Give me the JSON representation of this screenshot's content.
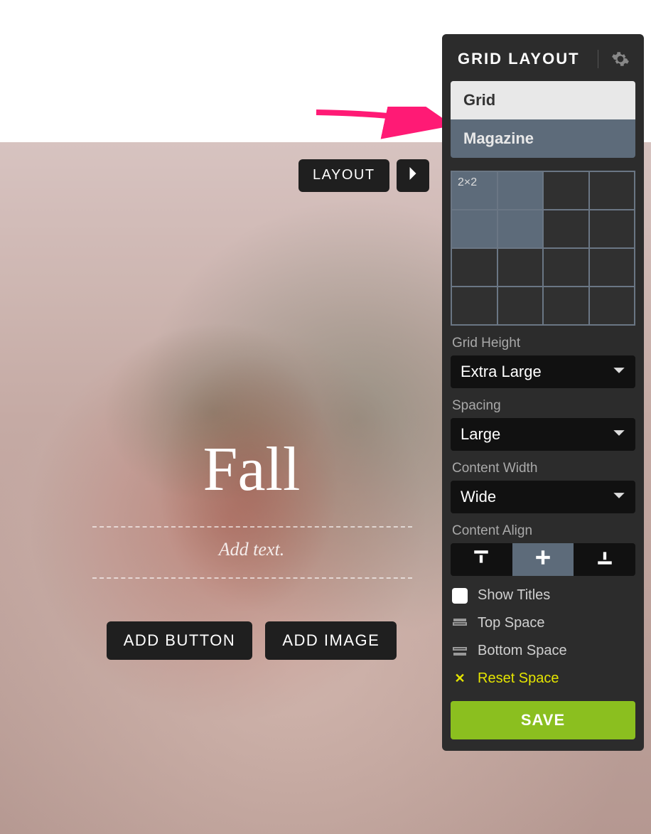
{
  "canvas": {
    "layout_button": "LAYOUT",
    "title": "Fall",
    "add_text_placeholder": "Add text.",
    "add_button_label": "ADD BUTTON",
    "add_image_label": "ADD IMAGE"
  },
  "panel": {
    "title": "GRID LAYOUT",
    "tabs": {
      "grid": "Grid",
      "magazine": "Magazine",
      "selected": "grid"
    },
    "grid_size_label": "2×2",
    "grid_height": {
      "label": "Grid Height",
      "value": "Extra Large"
    },
    "spacing": {
      "label": "Spacing",
      "value": "Large"
    },
    "content_width": {
      "label": "Content Width",
      "value": "Wide"
    },
    "content_align": {
      "label": "Content Align",
      "value": "middle"
    },
    "show_titles": {
      "label": "Show Titles",
      "checked": false
    },
    "top_space": "Top Space",
    "bottom_space": "Bottom Space",
    "reset_space": "Reset Space",
    "save": "SAVE"
  },
  "annotation": {
    "color": "#ff1a75"
  }
}
